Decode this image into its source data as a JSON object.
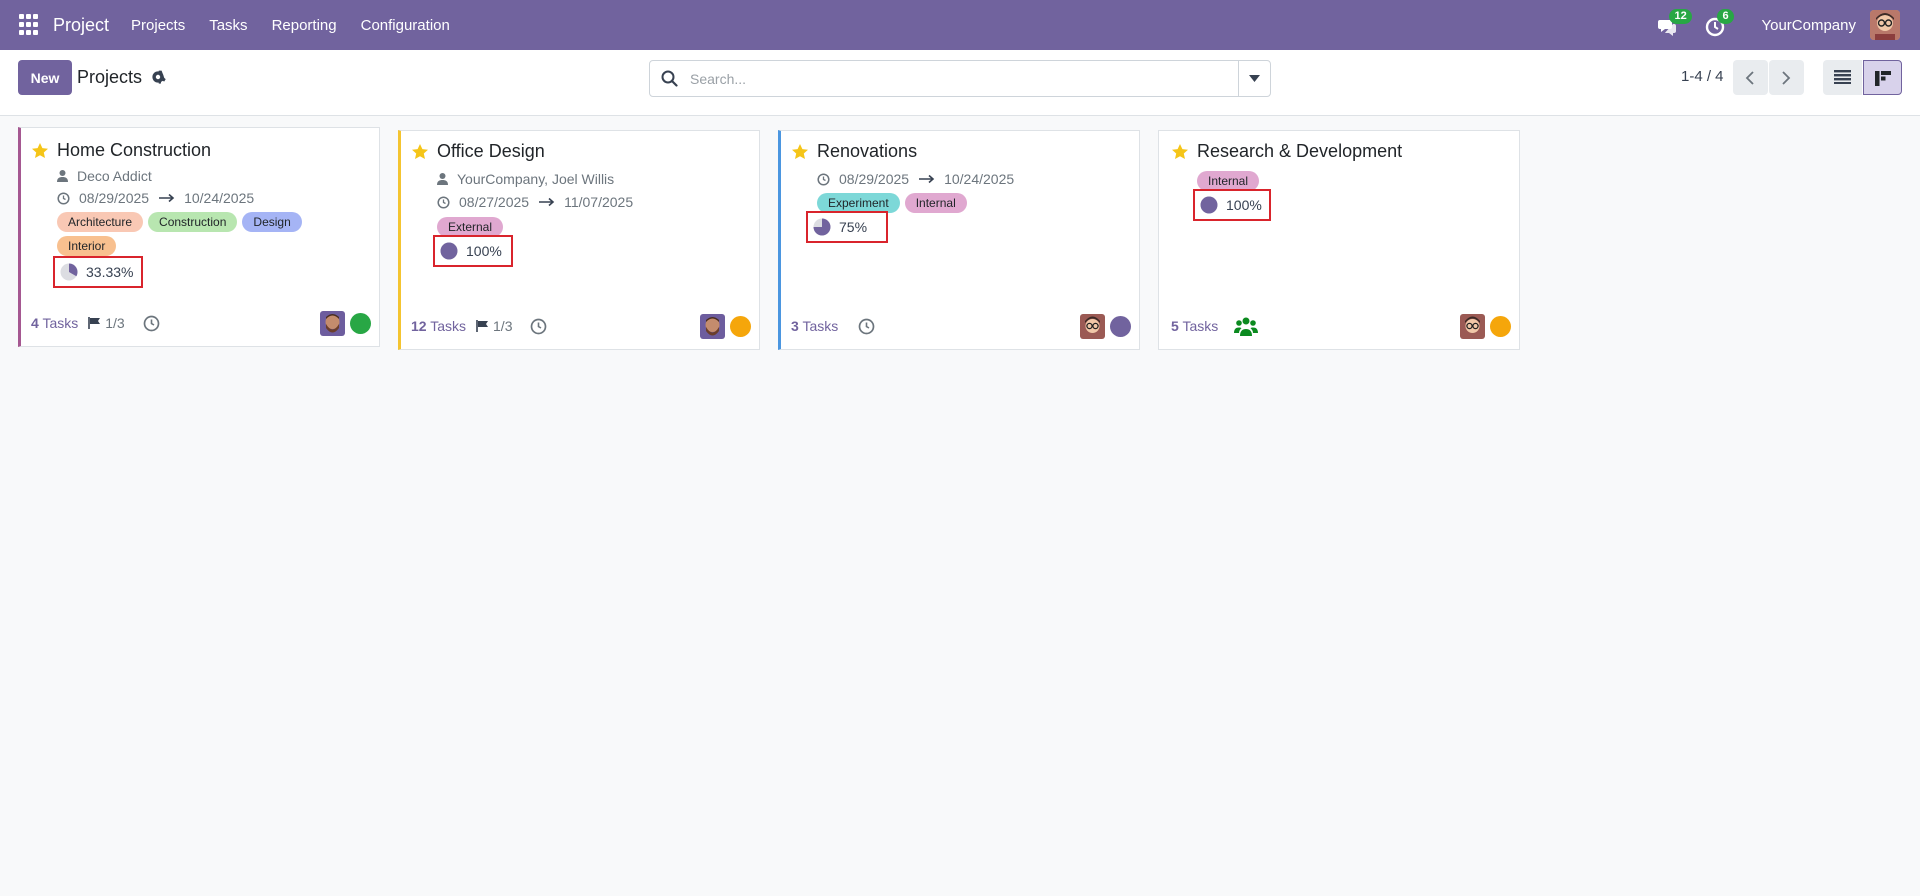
{
  "navbar": {
    "brand": "Project",
    "menus": [
      "Projects",
      "Tasks",
      "Reporting",
      "Configuration"
    ],
    "messages_count": "12",
    "activities_count": "6",
    "company": "YourCompany",
    "bg_color": "#71639e"
  },
  "control": {
    "new_label": "New",
    "title": "Projects",
    "search_placeholder": "Search...",
    "pager": "1-4 / 4",
    "active_view": "kanban"
  },
  "projects": [
    {
      "name": "Home Construction",
      "customer": "Deco Addict",
      "date_start": "08/29/2025",
      "date_end": "10/24/2025",
      "tags": [
        {
          "label": "Architecture",
          "color": "#f9c8b4"
        },
        {
          "label": "Construction",
          "color": "#b8e6b0"
        },
        {
          "label": "Design",
          "color": "#a5b4f5"
        },
        {
          "label": "Interior",
          "color": "#f8c08f"
        }
      ],
      "progress": "33.33%",
      "progress_fraction": 0.3333,
      "tasks_count": "4",
      "tasks_label": "Tasks",
      "milestones": "1/3",
      "status_color": "#28a745",
      "border_color": "#a55891",
      "avatar": "man"
    },
    {
      "name": "Office Design",
      "customer": "YourCompany, Joel Willis",
      "date_start": "08/27/2025",
      "date_end": "11/07/2025",
      "tags": [
        {
          "label": "External",
          "color": "#e0a8d0"
        }
      ],
      "progress": "100%",
      "progress_fraction": 1.0,
      "tasks_count": "12",
      "tasks_label": "Tasks",
      "milestones": "1/3",
      "status_color": "#f5a60b",
      "border_color": "#f4c430",
      "avatar": "man"
    },
    {
      "name": "Renovations",
      "date_start": "08/29/2025",
      "date_end": "10/24/2025",
      "tags": [
        {
          "label": "Experiment",
          "color": "#7dd8d8"
        },
        {
          "label": "Internal",
          "color": "#e0a8d0"
        }
      ],
      "progress": "75%",
      "progress_fraction": 0.75,
      "tasks_count": "3",
      "tasks_label": "Tasks",
      "status_color": "#71639e",
      "border_color": "#4b96e0",
      "avatar": "glasses"
    },
    {
      "name": "Research & Development",
      "tags": [
        {
          "label": "Internal",
          "color": "#e0a8d0"
        }
      ],
      "progress": "100%",
      "progress_fraction": 1.0,
      "tasks_count": "5",
      "tasks_label": "Tasks",
      "status_color": "#f5a60b",
      "border_color": "#dee2e6",
      "avatar": "glasses"
    }
  ]
}
